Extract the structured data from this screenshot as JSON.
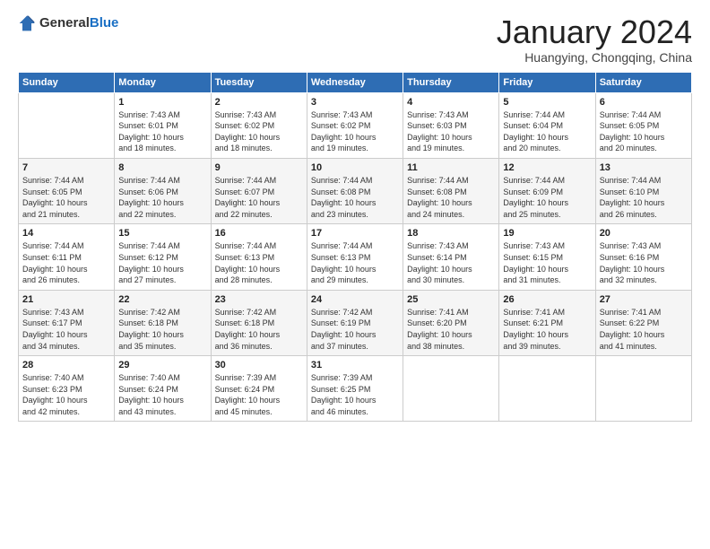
{
  "logo": {
    "text_general": "General",
    "text_blue": "Blue"
  },
  "calendar": {
    "title": "January 2024",
    "subtitle": "Huangying, Chongqing, China"
  },
  "headers": [
    "Sunday",
    "Monday",
    "Tuesday",
    "Wednesday",
    "Thursday",
    "Friday",
    "Saturday"
  ],
  "weeks": [
    [
      {
        "day": "",
        "info": ""
      },
      {
        "day": "1",
        "info": "Sunrise: 7:43 AM\nSunset: 6:01 PM\nDaylight: 10 hours\nand 18 minutes."
      },
      {
        "day": "2",
        "info": "Sunrise: 7:43 AM\nSunset: 6:02 PM\nDaylight: 10 hours\nand 18 minutes."
      },
      {
        "day": "3",
        "info": "Sunrise: 7:43 AM\nSunset: 6:02 PM\nDaylight: 10 hours\nand 19 minutes."
      },
      {
        "day": "4",
        "info": "Sunrise: 7:43 AM\nSunset: 6:03 PM\nDaylight: 10 hours\nand 19 minutes."
      },
      {
        "day": "5",
        "info": "Sunrise: 7:44 AM\nSunset: 6:04 PM\nDaylight: 10 hours\nand 20 minutes."
      },
      {
        "day": "6",
        "info": "Sunrise: 7:44 AM\nSunset: 6:05 PM\nDaylight: 10 hours\nand 20 minutes."
      }
    ],
    [
      {
        "day": "7",
        "info": "Sunrise: 7:44 AM\nSunset: 6:05 PM\nDaylight: 10 hours\nand 21 minutes."
      },
      {
        "day": "8",
        "info": "Sunrise: 7:44 AM\nSunset: 6:06 PM\nDaylight: 10 hours\nand 22 minutes."
      },
      {
        "day": "9",
        "info": "Sunrise: 7:44 AM\nSunset: 6:07 PM\nDaylight: 10 hours\nand 22 minutes."
      },
      {
        "day": "10",
        "info": "Sunrise: 7:44 AM\nSunset: 6:08 PM\nDaylight: 10 hours\nand 23 minutes."
      },
      {
        "day": "11",
        "info": "Sunrise: 7:44 AM\nSunset: 6:08 PM\nDaylight: 10 hours\nand 24 minutes."
      },
      {
        "day": "12",
        "info": "Sunrise: 7:44 AM\nSunset: 6:09 PM\nDaylight: 10 hours\nand 25 minutes."
      },
      {
        "day": "13",
        "info": "Sunrise: 7:44 AM\nSunset: 6:10 PM\nDaylight: 10 hours\nand 26 minutes."
      }
    ],
    [
      {
        "day": "14",
        "info": "Sunrise: 7:44 AM\nSunset: 6:11 PM\nDaylight: 10 hours\nand 26 minutes."
      },
      {
        "day": "15",
        "info": "Sunrise: 7:44 AM\nSunset: 6:12 PM\nDaylight: 10 hours\nand 27 minutes."
      },
      {
        "day": "16",
        "info": "Sunrise: 7:44 AM\nSunset: 6:13 PM\nDaylight: 10 hours\nand 28 minutes."
      },
      {
        "day": "17",
        "info": "Sunrise: 7:44 AM\nSunset: 6:13 PM\nDaylight: 10 hours\nand 29 minutes."
      },
      {
        "day": "18",
        "info": "Sunrise: 7:43 AM\nSunset: 6:14 PM\nDaylight: 10 hours\nand 30 minutes."
      },
      {
        "day": "19",
        "info": "Sunrise: 7:43 AM\nSunset: 6:15 PM\nDaylight: 10 hours\nand 31 minutes."
      },
      {
        "day": "20",
        "info": "Sunrise: 7:43 AM\nSunset: 6:16 PM\nDaylight: 10 hours\nand 32 minutes."
      }
    ],
    [
      {
        "day": "21",
        "info": "Sunrise: 7:43 AM\nSunset: 6:17 PM\nDaylight: 10 hours\nand 34 minutes."
      },
      {
        "day": "22",
        "info": "Sunrise: 7:42 AM\nSunset: 6:18 PM\nDaylight: 10 hours\nand 35 minutes."
      },
      {
        "day": "23",
        "info": "Sunrise: 7:42 AM\nSunset: 6:18 PM\nDaylight: 10 hours\nand 36 minutes."
      },
      {
        "day": "24",
        "info": "Sunrise: 7:42 AM\nSunset: 6:19 PM\nDaylight: 10 hours\nand 37 minutes."
      },
      {
        "day": "25",
        "info": "Sunrise: 7:41 AM\nSunset: 6:20 PM\nDaylight: 10 hours\nand 38 minutes."
      },
      {
        "day": "26",
        "info": "Sunrise: 7:41 AM\nSunset: 6:21 PM\nDaylight: 10 hours\nand 39 minutes."
      },
      {
        "day": "27",
        "info": "Sunrise: 7:41 AM\nSunset: 6:22 PM\nDaylight: 10 hours\nand 41 minutes."
      }
    ],
    [
      {
        "day": "28",
        "info": "Sunrise: 7:40 AM\nSunset: 6:23 PM\nDaylight: 10 hours\nand 42 minutes."
      },
      {
        "day": "29",
        "info": "Sunrise: 7:40 AM\nSunset: 6:24 PM\nDaylight: 10 hours\nand 43 minutes."
      },
      {
        "day": "30",
        "info": "Sunrise: 7:39 AM\nSunset: 6:24 PM\nDaylight: 10 hours\nand 45 minutes."
      },
      {
        "day": "31",
        "info": "Sunrise: 7:39 AM\nSunset: 6:25 PM\nDaylight: 10 hours\nand 46 minutes."
      },
      {
        "day": "",
        "info": ""
      },
      {
        "day": "",
        "info": ""
      },
      {
        "day": "",
        "info": ""
      }
    ]
  ]
}
